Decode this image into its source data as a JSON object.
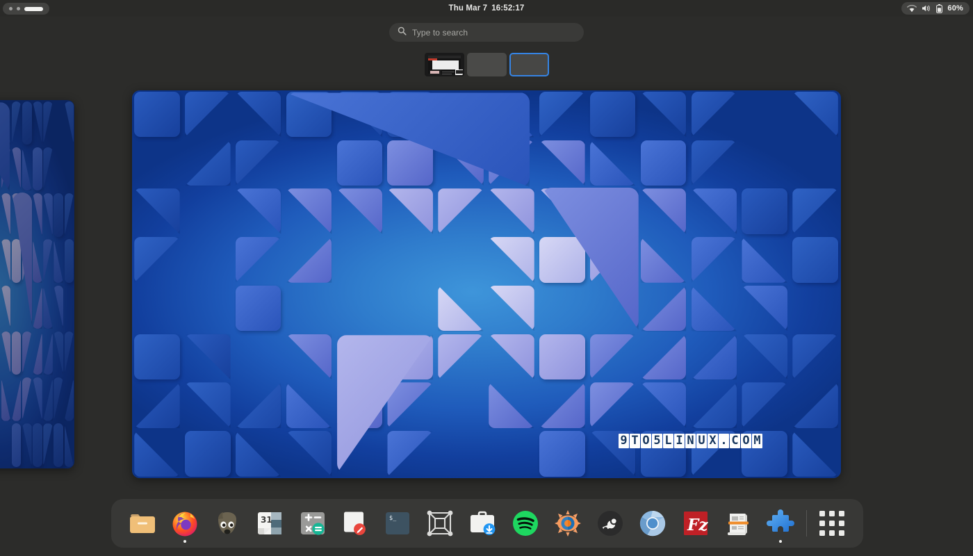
{
  "topbar": {
    "workspace_indicator": {
      "name": "workspace-switcher",
      "dots": 2,
      "active_index": 2
    },
    "clock": {
      "date": "Thu Mar 7",
      "time": "16:52:17"
    },
    "status": {
      "wifi_icon": "wifi-icon",
      "volume_icon": "volume-icon",
      "battery_icon": "battery-icon",
      "battery_percent": "60%"
    }
  },
  "search": {
    "icon": "search-icon",
    "placeholder": "Type to search",
    "value": ""
  },
  "workspace_thumbnails": [
    {
      "label": "Workspace 1",
      "selected": false,
      "has_window": true
    },
    {
      "label": "Workspace 2",
      "selected": false,
      "has_window": false
    },
    {
      "label": "Workspace 3",
      "selected": true,
      "has_window": false
    }
  ],
  "workspaces": {
    "current": {
      "label": "Current workspace preview",
      "wallpaper": "GNOME abstract blue tiles"
    },
    "previous": {
      "label": "Previous workspace preview",
      "wallpaper": "GNOME abstract blue tiles"
    }
  },
  "wallpaper": {
    "watermark": "9TO5LINUX.COM",
    "base_color": "#1f5bbb",
    "accent_color": "#3e95da"
  },
  "dock": {
    "items": [
      {
        "name": "dock-item-files",
        "label": "Files",
        "icon": "folder-icon",
        "running": false
      },
      {
        "name": "dock-item-firefox",
        "label": "Firefox",
        "icon": "firefox-icon",
        "running": true
      },
      {
        "name": "dock-item-gimp",
        "label": "GIMP",
        "icon": "gimp-icon",
        "running": false
      },
      {
        "name": "dock-item-calendar",
        "label": "Calendar",
        "icon": "calendar-icon",
        "running": false,
        "badge": "31"
      },
      {
        "name": "dock-item-calculator",
        "label": "Calculator",
        "icon": "calculator-icon",
        "running": false
      },
      {
        "name": "dock-item-text-editor",
        "label": "Text Editor",
        "icon": "text-editor-icon",
        "running": false
      },
      {
        "name": "dock-item-terminal",
        "label": "Terminal",
        "icon": "terminal-icon",
        "running": false
      },
      {
        "name": "dock-item-boxes",
        "label": "Boxes",
        "icon": "boxes-icon",
        "running": false
      },
      {
        "name": "dock-item-software",
        "label": "Software",
        "icon": "software-icon",
        "running": false
      },
      {
        "name": "dock-item-spotify",
        "label": "Spotify",
        "icon": "spotify-icon",
        "running": false
      },
      {
        "name": "dock-item-xnview",
        "label": "XnView",
        "icon": "xnview-icon",
        "running": false
      },
      {
        "name": "dock-item-steam",
        "label": "Steam",
        "icon": "steam-icon",
        "running": false
      },
      {
        "name": "dock-item-chromium",
        "label": "Chromium",
        "icon": "chromium-icon",
        "running": false
      },
      {
        "name": "dock-item-filezilla",
        "label": "FileZilla",
        "icon": "filezilla-icon",
        "running": false
      },
      {
        "name": "dock-item-news",
        "label": "News",
        "icon": "newspaper-icon",
        "running": false
      },
      {
        "name": "dock-item-extensions",
        "label": "Extensions",
        "icon": "puzzle-icon",
        "running": true
      }
    ],
    "show_apps": {
      "name": "show-applications-button",
      "label": "Show Applications",
      "icon": "app-grid-icon"
    }
  }
}
